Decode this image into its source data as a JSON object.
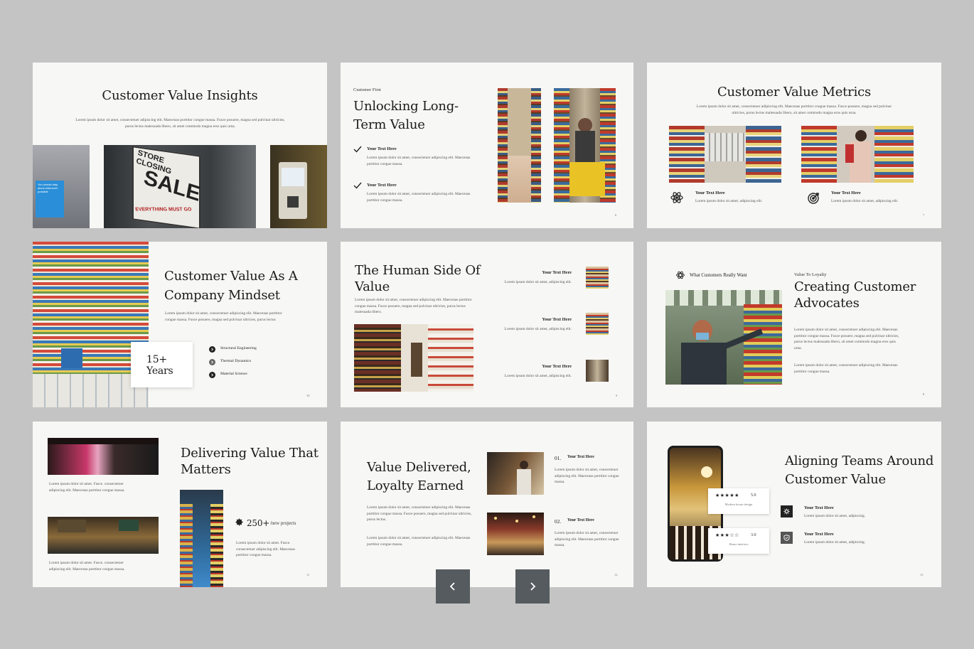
{
  "nav": {
    "prev_icon": "chevron-left-icon",
    "next_icon": "chevron-right-icon"
  },
  "slides": {
    "s1": {
      "title": "Customer Value Insights",
      "body": "Lorem ipsum dolor sit amet, consectetuer adipiscing elit. Maecenas porttitor congue massa. Fusce posuere, magna sed pulvinar ultricies, purus lectus malesuada libero, sit amet commodo magna eros quis urna.",
      "sign_blue": "You should stay alone whenever possible",
      "sign_store": "STORE CLOSING",
      "sign_sale": "SALE",
      "sign_everything": "EVERYTHING MUST GO"
    },
    "s2": {
      "kicker": "Customer First",
      "title_l1": "Unlocking Long-",
      "title_l2": "Term Value",
      "items": [
        {
          "title": "Your Text Here",
          "text": "Lorem ipsum dolor sit amet, consectetuer adipiscing elit. Maecenas porttitor congue massa."
        },
        {
          "title": "Your Text Here",
          "text": "Lorem ipsum dolor sit amet, consectetuer adipiscing elit. Maecenas porttitor congue massa."
        }
      ],
      "page": "6"
    },
    "s3": {
      "title": "Customer Value Metrics",
      "body": "Lorem ipsum dolor sit amet, consectetuer adipiscing elit. Maecenas porttitor congue massa. Fusce posuere, magna sed pulvinar ultricies, purus lectus malesuada libero, sit amet commodo magna eros quis urna.",
      "items": [
        {
          "title": "Your Text Here",
          "text": "Lorem ipsum dolor sit amet, adipiscing elit.",
          "icon": "atom-icon"
        },
        {
          "title": "Your Text Here",
          "text": "Lorem ipsum dolor sit amet, adipiscing elit.",
          "icon": "target-icon"
        }
      ],
      "page": "7"
    },
    "s4": {
      "title_l1": "Customer Value As A",
      "title_l2": "Company Mindset",
      "body": "Lorem ipsum dolor sit amet, consectetuer adipiscing elit. Maecenas porttitor congue massa. Fusce posuere, magna sed pulvinar ultricies, purus lectus",
      "badge_l1": "15+",
      "badge_l2": "Years",
      "list": [
        "Structural Engineering",
        "Thermal Dynamics",
        "Material Science"
      ],
      "page": "10"
    },
    "s5": {
      "title_l1": "The Human Side Of",
      "title_l2": "Value",
      "body": "Lorem ipsum dolor sit amet, consectetuer adipiscing elit. Maecenas porttitor congue massa. Fusce posuere, magna sed pulvinar ultricies, purus lectus malesuada libero.",
      "items": [
        {
          "title": "Your Text Here",
          "text": "Lorem ipsum dolor sit amet, adipiscing elit."
        },
        {
          "title": "Your Text Here",
          "text": "Lorem ipsum dolor sit amet, adipiscing elit."
        },
        {
          "title": "Your Text Here",
          "text": "Lorem ipsum dolor sit amet, adipiscing elit."
        }
      ],
      "page": "9"
    },
    "s6": {
      "label": "What Customers Really Want",
      "kicker": "Value To Loyalty",
      "title_l1": "Creating Customer",
      "title_l2": "Advocates",
      "body1": "Lorem ipsum dolor sit amet, consectetuer adipiscing elit. Maecenas porttitor congue massa. Fusce posuere, magna sed pulvinar ultricies, purus lectus malesuada libero, sit amet commodo magna eros quis urna.",
      "body2": "Lorem ipsum dolor sit amet, consectetuer adipiscing elit. Maecenas porttitor congue massa.",
      "page": "8"
    },
    "s7": {
      "title_l1": "Delivering Value That",
      "title_l2": "Matters",
      "caption1": "Lorem ipsum dolor sit amet. Fusce. consectetuer adipiscing elit. Maecenas porttitor congue massa.",
      "caption2": "Lorem ipsum dolor sit amet. Fusce. consectetuer adipiscing elit. Maecenas porttitor congue massa.",
      "stat_value": "250+",
      "stat_label": "/new projects",
      "body": "Lorem ipsum dolor sit amet. Fusce. consectetuer adipiscing elit. Maecenas porttitor congue massa.",
      "page": "11"
    },
    "s8": {
      "title_l1": "Value Delivered,",
      "title_l2": "Loyalty Earned",
      "body1": "Lorem ipsum dolor sit amet, consectetuer adipiscing elit. Maecenas porttitor congue massa. Fusce posuere, magna sed pulvinar ultricies, purus lectus.",
      "body2": "Lorem ipsum dolor sit amet, consectetuer adipiscing elit. Maecenas porttitor congue massa.",
      "items": [
        {
          "num": "01.",
          "title": "Your Text Here",
          "text": "Lorem ipsum dolor sit amet, consectetuer adipiscing elit. Maecenas porttitor congue massa."
        },
        {
          "num": "02.",
          "title": "Your Text Here",
          "text": "Lorem ipsum dolor sit amet, consectetuer adipiscing elit. Maecenas porttitor congue massa."
        }
      ],
      "page": "12"
    },
    "s9": {
      "title_l1": "Aligning Teams Around",
      "title_l2": "Customer Value",
      "cards": [
        {
          "stars": "★★★★★",
          "score": "5.0",
          "label": "Modern house design"
        },
        {
          "stars": "★★★☆☆",
          "score": "3.0",
          "label": "Home interiors"
        }
      ],
      "items": [
        {
          "title": "Your Text Here",
          "text": "Lorem ipsum dolor sit amet, adipiscing."
        },
        {
          "title": "Your Text Here",
          "text": "Lorem ipsum dolor sit amet, adipiscing."
        }
      ],
      "page": "13"
    }
  }
}
